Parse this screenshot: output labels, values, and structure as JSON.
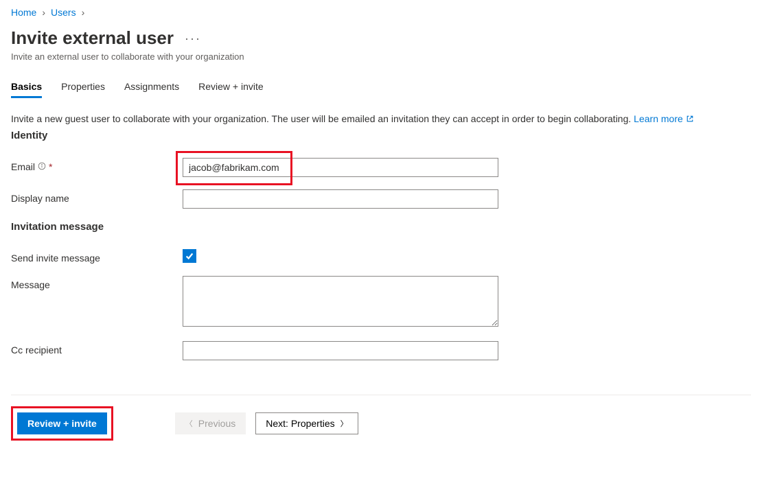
{
  "breadcrumb": {
    "home": "Home",
    "users": "Users"
  },
  "page": {
    "title": "Invite external user",
    "subtitle": "Invite an external user to collaborate with your organization"
  },
  "tabs": {
    "basics": "Basics",
    "properties": "Properties",
    "assignments": "Assignments",
    "review": "Review + invite"
  },
  "intro": {
    "text": "Invite a new guest user to collaborate with your organization. The user will be emailed an invitation they can accept in order to begin collaborating.",
    "learn_more": "Learn more"
  },
  "sections": {
    "identity": "Identity",
    "invitation": "Invitation message"
  },
  "labels": {
    "email": "Email",
    "display_name": "Display name",
    "send_invite": "Send invite message",
    "message": "Message",
    "cc": "Cc recipient"
  },
  "values": {
    "email": "jacob@fabrikam.com",
    "display_name": "",
    "message": "",
    "cc": ""
  },
  "footer": {
    "review": "Review + invite",
    "previous": "Previous",
    "next": "Next: Properties"
  }
}
